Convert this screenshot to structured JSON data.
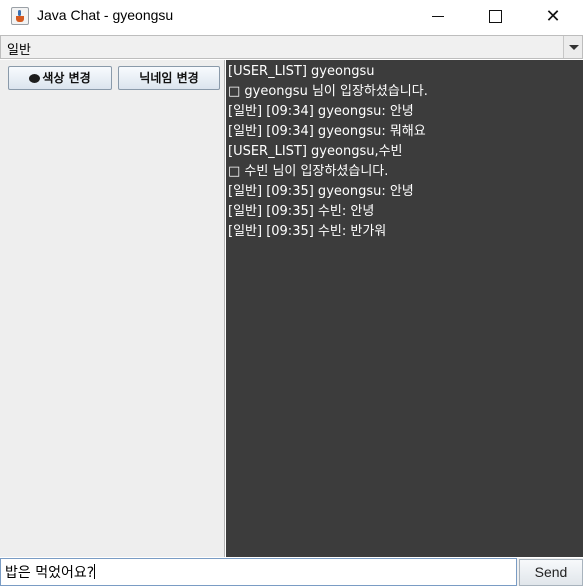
{
  "window": {
    "title": "Java Chat - gyeongsu",
    "minimize_glyph": "—",
    "close_glyph": "✕"
  },
  "room_select": {
    "value": "일반"
  },
  "buttons": {
    "color_change": "색상 변경",
    "nickname_change": "닉네임 변경",
    "send": "Send"
  },
  "messages": [
    "[USER_LIST] gyeongsu",
    "□ gyeongsu 님이 입장하셨습니다.",
    "[일반] [09:34] gyeongsu: 안녕",
    "[일반] [09:34] gyeongsu: 뭐해요",
    "[USER_LIST] gyeongsu,수빈",
    "□ 수빈 님이 입장하셨습니다.",
    "[일반] [09:35] gyeongsu: 안녕",
    "[일반] [09:35] 수빈: 안녕",
    "[일반] [09:35] 수빈: 반가워"
  ],
  "input": {
    "value": "밥은 먹었어요?"
  },
  "colors": {
    "chat_background": "#3c3c3c",
    "chat_text": "#ffffff",
    "left_panel": "#eeeeee"
  },
  "icons": {
    "app": "java-coffee-icon",
    "palette": "palette-icon",
    "dropdown": "chevron-down-icon"
  }
}
